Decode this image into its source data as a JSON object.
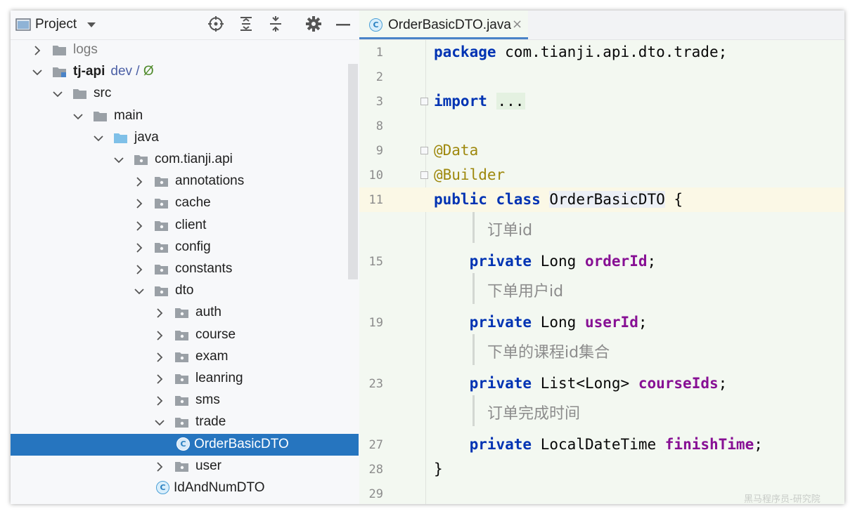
{
  "project_panel": {
    "title": "Project",
    "tree": [
      {
        "label": "logs",
        "expanded": false,
        "type": "folder"
      },
      {
        "label": "tj-api",
        "branch": "dev",
        "sep": " / ",
        "symbol": "Ø",
        "expanded": true,
        "type": "module"
      },
      {
        "label": "src",
        "expanded": true,
        "type": "folder"
      },
      {
        "label": "main",
        "expanded": true,
        "type": "folder"
      },
      {
        "label": "java",
        "expanded": true,
        "type": "source-folder"
      },
      {
        "label": "com.tianji.api",
        "expanded": true,
        "type": "package"
      },
      {
        "label": "annotations",
        "expanded": false,
        "type": "package"
      },
      {
        "label": "cache",
        "expanded": false,
        "type": "package"
      },
      {
        "label": "client",
        "expanded": false,
        "type": "package"
      },
      {
        "label": "config",
        "expanded": false,
        "type": "package"
      },
      {
        "label": "constants",
        "expanded": false,
        "type": "package"
      },
      {
        "label": "dto",
        "expanded": true,
        "type": "package"
      },
      {
        "label": "auth",
        "expanded": false,
        "type": "package"
      },
      {
        "label": "course",
        "expanded": false,
        "type": "package"
      },
      {
        "label": "exam",
        "expanded": false,
        "type": "package"
      },
      {
        "label": "leanring",
        "expanded": false,
        "type": "package"
      },
      {
        "label": "sms",
        "expanded": false,
        "type": "package"
      },
      {
        "label": "trade",
        "expanded": true,
        "type": "package"
      },
      {
        "label": "OrderBasicDTO",
        "type": "class",
        "selected": true
      },
      {
        "label": "user",
        "expanded": false,
        "type": "package"
      },
      {
        "label": "IdAndNumDTO",
        "type": "class"
      }
    ]
  },
  "editor": {
    "tab_label": "OrderBasicDTO.java",
    "tab_close": "×",
    "class_icon_letter": "C",
    "lines": [
      {
        "num": "1",
        "kw": "package",
        "rest": " com.tianji.api.dto.trade;"
      },
      {
        "num": "2"
      },
      {
        "num": "3",
        "kw": "import",
        "folded": "..."
      },
      {
        "num": "8"
      },
      {
        "num": "9",
        "annotation": "@Data"
      },
      {
        "num": "10",
        "annotation": "@Builder"
      },
      {
        "num": "11",
        "kw1": "public",
        "kw2": "class",
        "class_name": "OrderBasicDTO",
        "rest": " {"
      },
      {
        "doc": "订单id"
      },
      {
        "num": "15",
        "kw": "private",
        "type": "Long",
        "field": "orderId"
      },
      {
        "doc": "下单用户id"
      },
      {
        "num": "19",
        "kw": "private",
        "type": "Long",
        "field": "userId"
      },
      {
        "doc": "下单的课程id集合"
      },
      {
        "num": "23",
        "kw": "private",
        "type": "List<Long>",
        "field": "courseIds"
      },
      {
        "doc": "订单完成时间"
      },
      {
        "num": "27",
        "kw": "private",
        "type": "LocalDateTime",
        "field": "finishTime"
      },
      {
        "num": "28",
        "rest": "}"
      },
      {
        "num": "29"
      }
    ]
  },
  "watermark": "黑马程序员-研究院",
  "colors": {
    "selection": "#2675bf",
    "keyword": "#0033b3",
    "annotation": "#9e880d",
    "field": "#871094",
    "current_line": "#fbf8e6",
    "editor_bg": "#f3f8f1"
  }
}
